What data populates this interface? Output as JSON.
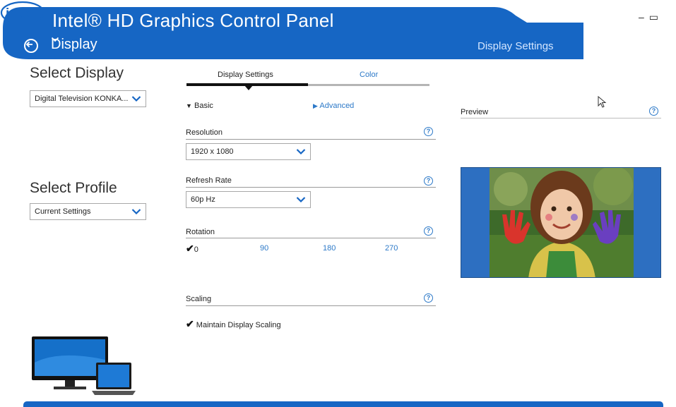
{
  "app": {
    "title": "Intel® HD Graphics Control Panel",
    "section": "Display",
    "page": "Display Settings",
    "logo_text": "intel",
    "window_controls": [
      "–",
      "▭"
    ]
  },
  "left": {
    "select_display_title": "Select Display",
    "display_dropdown": "Digital Television KONKA...",
    "select_profile_title": "Select Profile",
    "profile_dropdown": "Current Settings"
  },
  "tabs": [
    {
      "label": "Display Settings",
      "active": true
    },
    {
      "label": "Color",
      "active": false
    }
  ],
  "modes": {
    "basic": "Basic",
    "advanced": "Advanced"
  },
  "resolution": {
    "label": "Resolution",
    "value": "1920 x 1080"
  },
  "refresh_rate": {
    "label": "Refresh Rate",
    "value": "60p Hz"
  },
  "rotation": {
    "label": "Rotation",
    "options": [
      "0",
      "90",
      "180",
      "270"
    ],
    "selected": "0"
  },
  "scaling": {
    "label": "Scaling",
    "option": "Maintain Display Scaling",
    "checked": true
  },
  "preview": {
    "label": "Preview"
  },
  "colors": {
    "accent": "#1666c4",
    "link": "#2c79c8"
  },
  "icons": {
    "back": "back-arrow-icon",
    "chevron": "chevron-down-icon",
    "help": "help-icon",
    "check": "checkmark-icon"
  }
}
